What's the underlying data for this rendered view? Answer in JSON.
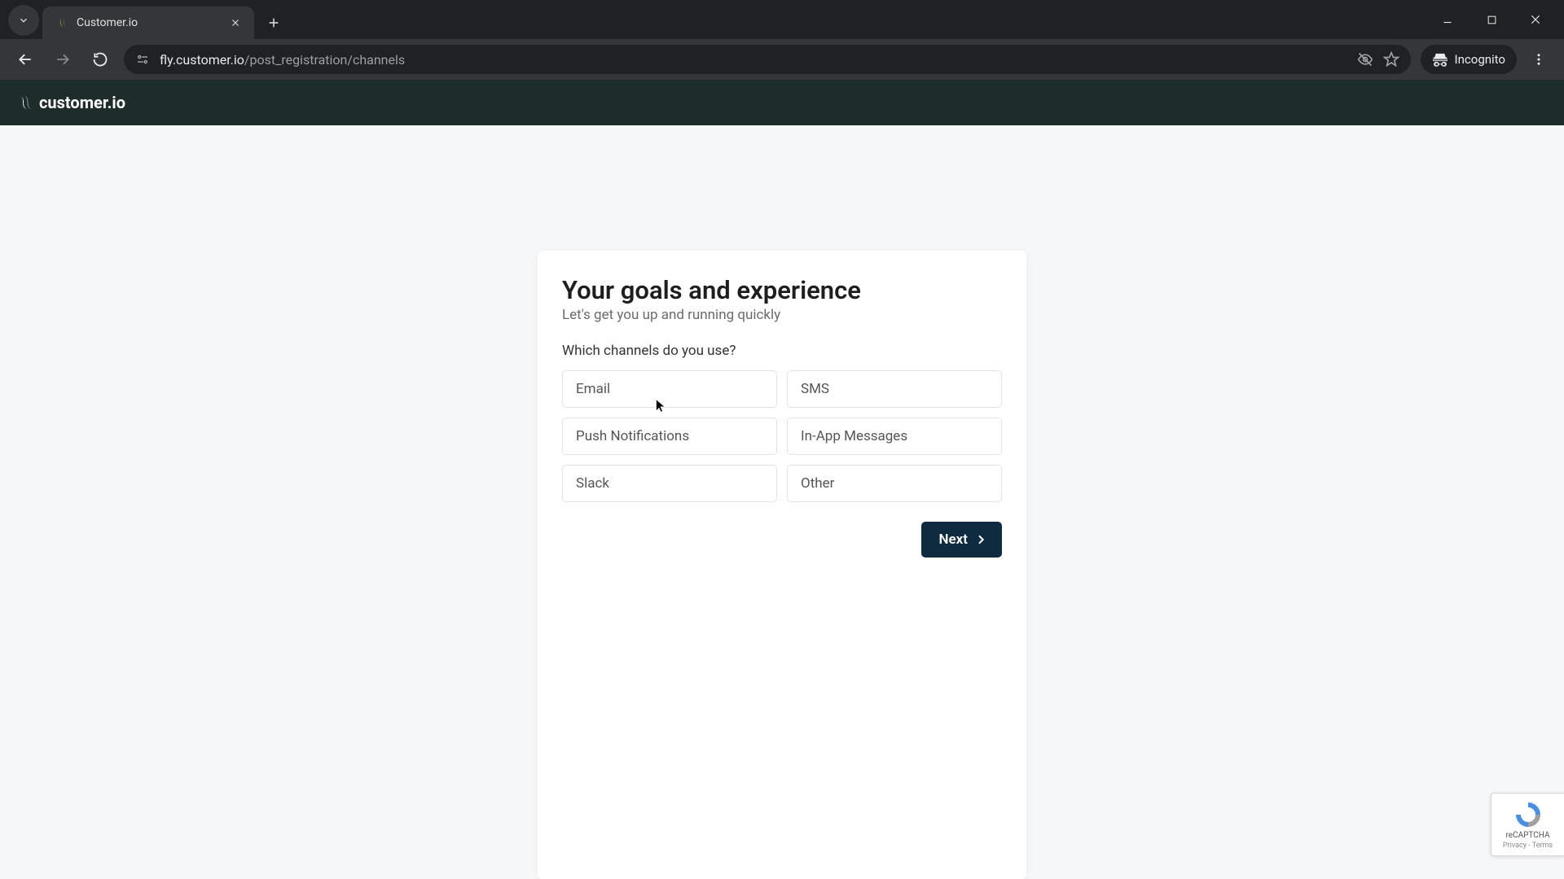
{
  "browser": {
    "tab_title": "Customer.io",
    "url_host": "fly.customer.io",
    "url_path": "/post_registration/channels",
    "incognito_label": "Incognito"
  },
  "app": {
    "brand_name": "customer.io"
  },
  "card": {
    "heading": "Your goals and experience",
    "subtitle": "Let's get you up and running quickly",
    "question": "Which channels do you use?",
    "options": [
      "Email",
      "SMS",
      "Push Notifications",
      "In-App Messages",
      "Slack",
      "Other"
    ],
    "next_label": "Next"
  },
  "recaptcha": {
    "title": "reCAPTCHA",
    "sub": "Privacy - Terms"
  }
}
